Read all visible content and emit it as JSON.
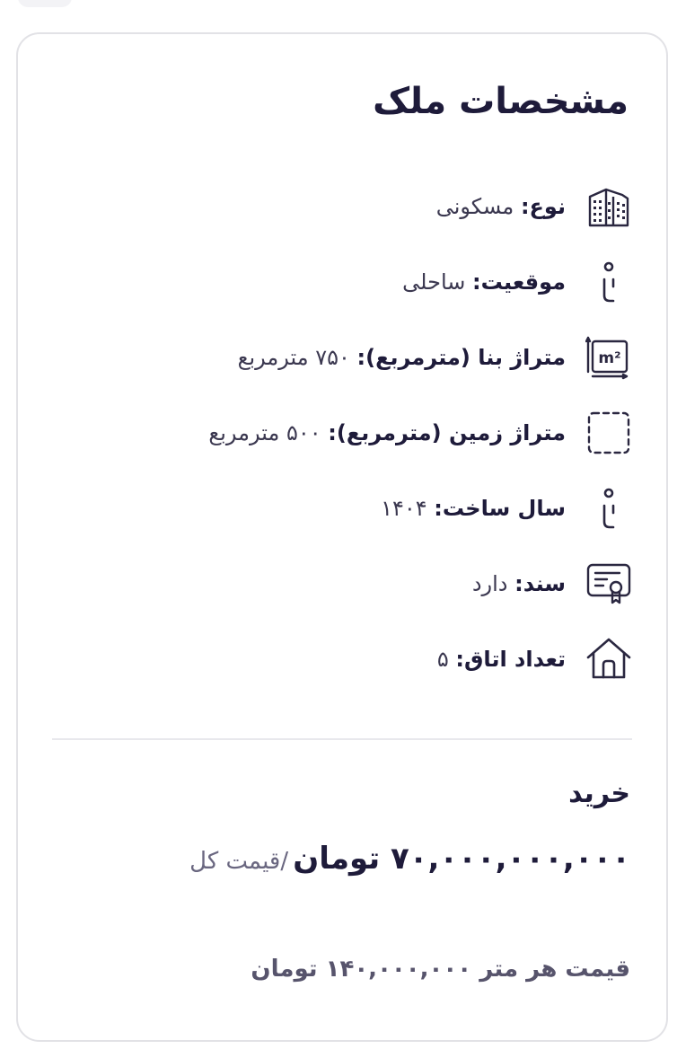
{
  "title": "مشخصات ملک",
  "specs": [
    {
      "icon": "building-icon",
      "label": "نوع:",
      "value": "مسکونی"
    },
    {
      "icon": "location-pin-icon",
      "label": "موقعیت:",
      "value": "ساحلی"
    },
    {
      "icon": "area-m2-icon",
      "label": "متراژ بنا (مترمربع):",
      "value": "۷۵۰ مترمربع"
    },
    {
      "icon": "land-area-icon",
      "label": "متراژ زمین (مترمربع):",
      "value": "۵۰۰ مترمربع"
    },
    {
      "icon": "location-pin-icon",
      "label": "سال ساخت:",
      "value": "۱۴۰۴"
    },
    {
      "icon": "certificate-icon",
      "label": "سند:",
      "value": "دارد"
    },
    {
      "icon": "house-icon",
      "label": "تعداد اتاق:",
      "value": "۵"
    }
  ],
  "deal": {
    "type": "خرید",
    "price": "۷۰,۰۰۰,۰۰۰,۰۰۰ تومان",
    "price_suffix": "/قیمت کل",
    "price_per_meter": "قیمت هر متر ۱۴۰,۰۰۰,۰۰۰ تومان"
  }
}
